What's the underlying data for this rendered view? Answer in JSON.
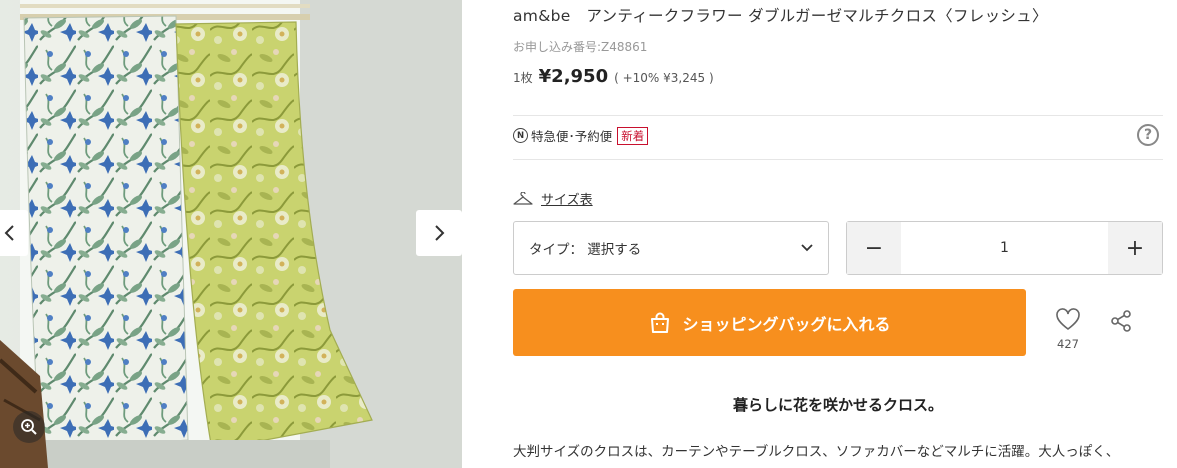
{
  "product": {
    "title": "am&be　アンティークフラワー ダブルガーゼマルチクロス〈フレッシュ〉",
    "order_number": "お申し込み番号:Z48861",
    "unit": "1枚",
    "price": "¥2,950",
    "tax_info": "( +10% ¥3,245 )",
    "shipping_badge_letter": "N",
    "shipping_label": "特急便･予約便",
    "new_badge": "新着",
    "help_label": "?"
  },
  "size_chart": {
    "label": "サイズ表",
    "icon": "hanger-icon"
  },
  "type_select": {
    "value": "タイプ： 選択する",
    "icon": "chevron-down-icon"
  },
  "quantity": {
    "minus": "−",
    "value": "1",
    "plus": "+"
  },
  "cart_button": {
    "label": "ショッピングバッグに入れる",
    "icon": "shopping-bag-icon"
  },
  "favorite": {
    "icon": "heart-icon",
    "count": "427"
  },
  "share": {
    "icon": "share-icon"
  },
  "description": {
    "headline": "暮らしに花を咲かせるクロス。",
    "body": "大判サイズのクロスは、カーテンやテーブルクロス、ソファカバーなどマルチに活躍。大人っぽく、"
  },
  "colors": {
    "accent": "#f78f1e",
    "new_badge": "#c8102e",
    "text": "#333333",
    "muted": "#999999"
  }
}
